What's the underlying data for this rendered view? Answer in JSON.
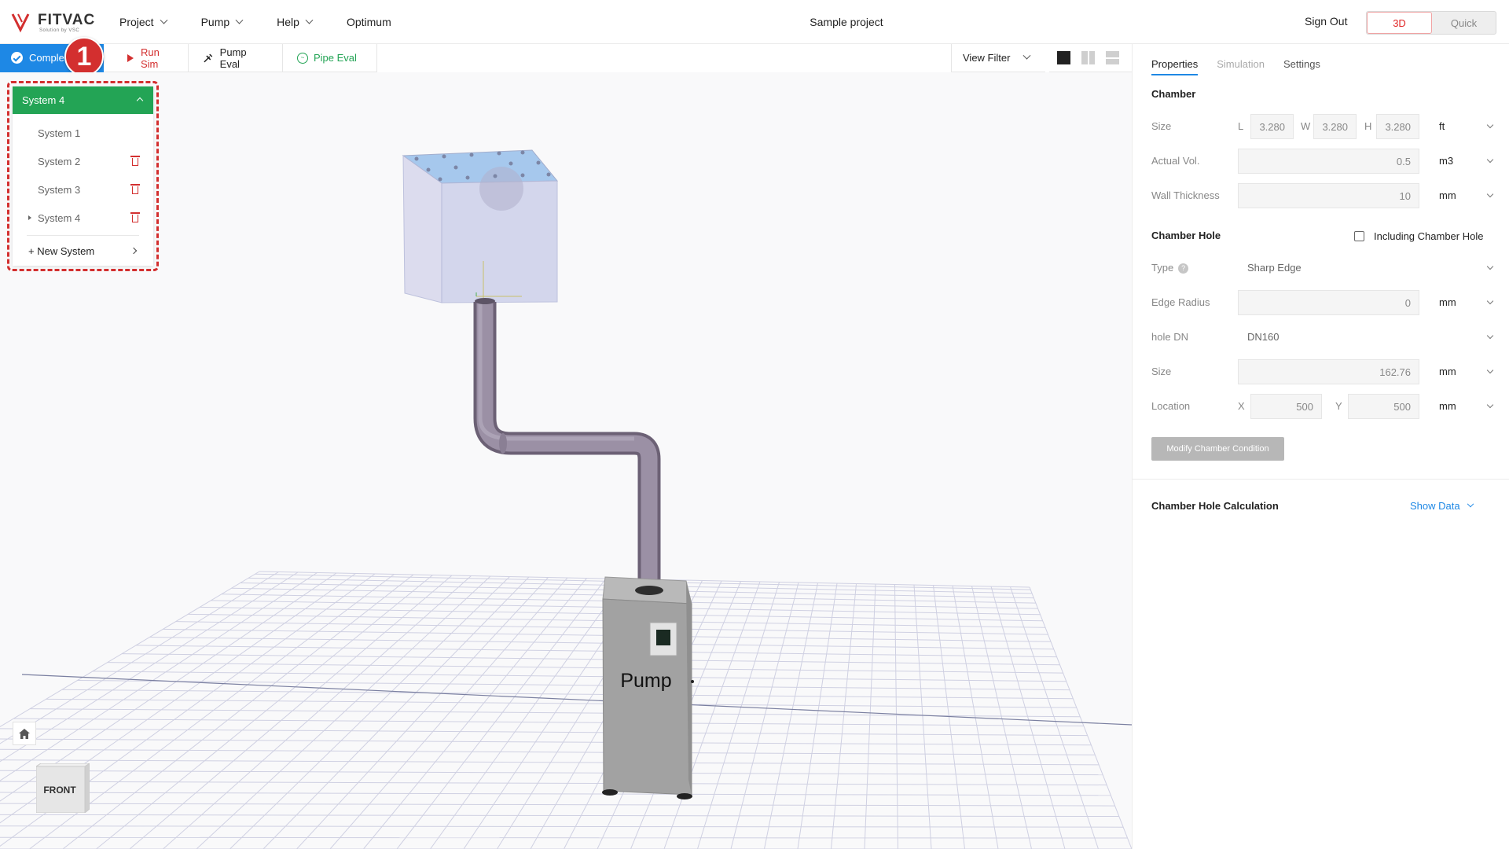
{
  "header": {
    "brand": "FITVAC",
    "brand_sub": "Solution by VSC",
    "menu": [
      {
        "label": "Project",
        "has_dropdown": true
      },
      {
        "label": "Pump",
        "has_dropdown": true
      },
      {
        "label": "Help",
        "has_dropdown": true
      },
      {
        "label": "Optimum",
        "has_dropdown": false
      }
    ],
    "project_title": "Sample project",
    "sign_out": "Sign Out",
    "view_modes": {
      "active": "3D",
      "inactive": "Quick"
    }
  },
  "toolbar": {
    "complete": "Complete",
    "run_sim": "Run Sim",
    "pump_eval": "Pump Eval",
    "pipe_eval": "Pipe Eval",
    "step_badge": "1",
    "view_filter": "View Filter"
  },
  "systems": {
    "selected": "System 4",
    "items": [
      {
        "label": "System 1",
        "deletable": false
      },
      {
        "label": "System 2",
        "deletable": true
      },
      {
        "label": "System 3",
        "deletable": true
      },
      {
        "label": "System 4",
        "deletable": true,
        "expandable": true
      }
    ],
    "new_system": "+ New System"
  },
  "scene": {
    "pump_label": "Pump",
    "cube_face": "FRONT"
  },
  "panel": {
    "tabs": {
      "properties": "Properties",
      "simulation": "Simulation",
      "settings": "Settings"
    },
    "chamber": {
      "title": "Chamber",
      "size_label": "Size",
      "size_l_label": "L",
      "size_l": "3.280",
      "size_w_label": "W",
      "size_w": "3.280",
      "size_h_label": "H",
      "size_h": "3.280",
      "size_unit": "ft",
      "actual_vol_label": "Actual Vol.",
      "actual_vol": "0.5",
      "actual_vol_unit": "m3",
      "wall_thickness_label": "Wall Thickness",
      "wall_thickness": "10",
      "wall_thickness_unit": "mm"
    },
    "chamber_hole": {
      "title": "Chamber Hole",
      "including_label": "Including Chamber Hole",
      "including_checked": false,
      "type_label": "Type",
      "type_value": "Sharp Edge",
      "edge_radius_label": "Edge Radius",
      "edge_radius": "0",
      "edge_radius_unit": "mm",
      "hole_dn_label": "hole DN",
      "hole_dn": "DN160",
      "size_label": "Size",
      "size": "162.76",
      "size_unit": "mm",
      "location_label": "Location",
      "x_label": "X",
      "x": "500",
      "y_label": "Y",
      "y": "500",
      "location_unit": "mm",
      "modify_button": "Modify Chamber Condition"
    },
    "calculation": {
      "title": "Chamber Hole Calculation",
      "show_data": "Show Data"
    }
  },
  "colors": {
    "accent_blue": "#1e88e5",
    "run_red": "#d32f2f",
    "system_green": "#23a455",
    "pipe": "#8d8094"
  }
}
